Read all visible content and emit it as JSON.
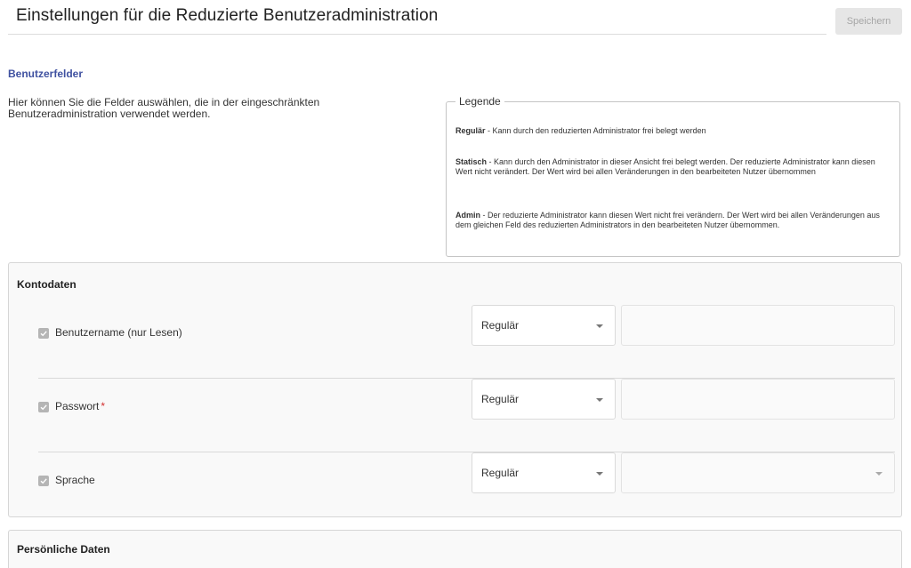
{
  "header": {
    "title": "Einstellungen für die Reduzierte Benutzeradministration",
    "save_label": "Speichern"
  },
  "section": {
    "heading": "Benutzerfelder",
    "intro": "Hier können Sie die Felder auswählen, die in der eingeschränkten Benutzeradministration verwendet werden."
  },
  "legend": {
    "title": "Legende",
    "entries": [
      {
        "term": "Regulär",
        "text": " - Kann durch den reduzierten Administrator frei belegt werden"
      },
      {
        "term": "Statisch",
        "text": " - Kann durch den Administrator in dieser Ansicht frei belegt werden. Der reduzierte Administrator kann diesen Wert nicht verändert. Der Wert wird bei allen Veränderungen in den bearbeiteten Nutzer übernommen"
      },
      {
        "term": "Admin",
        "text": " - Der reduzierte Administrator kann diesen Wert nicht frei verändern. Der Wert wird bei allen Veränderungen aus dem gleichen Feld des reduzierten Administrators in den bearbeiteten Nutzer übernommen."
      }
    ]
  },
  "cards": [
    {
      "title": "Kontodaten",
      "fields": [
        {
          "label": "Benutzername (nur Lesen)",
          "checked": true,
          "required": false,
          "mode": "Regulär",
          "value": ""
        },
        {
          "label": "Passwort",
          "checked": true,
          "required": true,
          "required_mark": "*",
          "mode": "Regulär",
          "value": ""
        },
        {
          "label": "Sprache",
          "checked": true,
          "required": false,
          "mode": "Regulär",
          "value": ""
        }
      ]
    },
    {
      "title": "Persönliche Daten",
      "fields": []
    }
  ],
  "colors": {
    "accent_heading": "#3f51a0",
    "required": "#d32f2f",
    "checkbox_disabled": "#b5b5b5"
  }
}
